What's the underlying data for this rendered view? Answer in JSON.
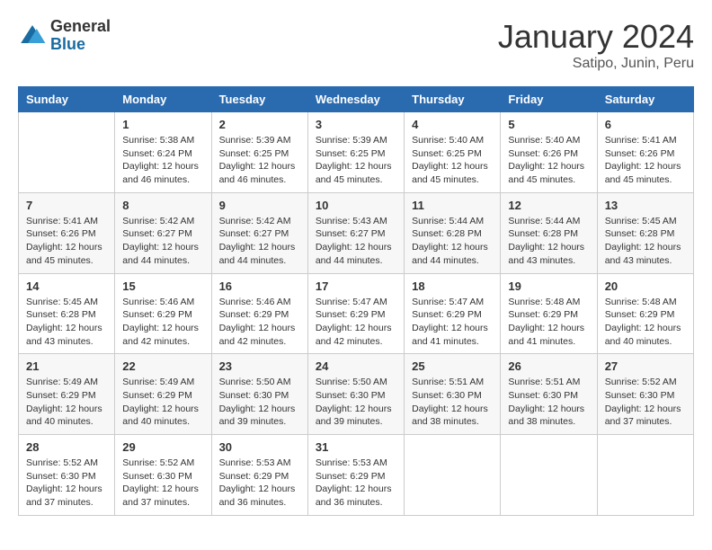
{
  "header": {
    "logo_general": "General",
    "logo_blue": "Blue",
    "title": "January 2024",
    "location": "Satipo, Junin, Peru"
  },
  "calendar": {
    "days_of_week": [
      "Sunday",
      "Monday",
      "Tuesday",
      "Wednesday",
      "Thursday",
      "Friday",
      "Saturday"
    ],
    "weeks": [
      [
        {
          "day": "",
          "info": ""
        },
        {
          "day": "1",
          "info": "Sunrise: 5:38 AM\nSunset: 6:24 PM\nDaylight: 12 hours and 46 minutes."
        },
        {
          "day": "2",
          "info": "Sunrise: 5:39 AM\nSunset: 6:25 PM\nDaylight: 12 hours and 46 minutes."
        },
        {
          "day": "3",
          "info": "Sunrise: 5:39 AM\nSunset: 6:25 PM\nDaylight: 12 hours and 45 minutes."
        },
        {
          "day": "4",
          "info": "Sunrise: 5:40 AM\nSunset: 6:25 PM\nDaylight: 12 hours and 45 minutes."
        },
        {
          "day": "5",
          "info": "Sunrise: 5:40 AM\nSunset: 6:26 PM\nDaylight: 12 hours and 45 minutes."
        },
        {
          "day": "6",
          "info": "Sunrise: 5:41 AM\nSunset: 6:26 PM\nDaylight: 12 hours and 45 minutes."
        }
      ],
      [
        {
          "day": "7",
          "info": "Sunrise: 5:41 AM\nSunset: 6:26 PM\nDaylight: 12 hours and 45 minutes."
        },
        {
          "day": "8",
          "info": "Sunrise: 5:42 AM\nSunset: 6:27 PM\nDaylight: 12 hours and 44 minutes."
        },
        {
          "day": "9",
          "info": "Sunrise: 5:42 AM\nSunset: 6:27 PM\nDaylight: 12 hours and 44 minutes."
        },
        {
          "day": "10",
          "info": "Sunrise: 5:43 AM\nSunset: 6:27 PM\nDaylight: 12 hours and 44 minutes."
        },
        {
          "day": "11",
          "info": "Sunrise: 5:44 AM\nSunset: 6:28 PM\nDaylight: 12 hours and 44 minutes."
        },
        {
          "day": "12",
          "info": "Sunrise: 5:44 AM\nSunset: 6:28 PM\nDaylight: 12 hours and 43 minutes."
        },
        {
          "day": "13",
          "info": "Sunrise: 5:45 AM\nSunset: 6:28 PM\nDaylight: 12 hours and 43 minutes."
        }
      ],
      [
        {
          "day": "14",
          "info": "Sunrise: 5:45 AM\nSunset: 6:28 PM\nDaylight: 12 hours and 43 minutes."
        },
        {
          "day": "15",
          "info": "Sunrise: 5:46 AM\nSunset: 6:29 PM\nDaylight: 12 hours and 42 minutes."
        },
        {
          "day": "16",
          "info": "Sunrise: 5:46 AM\nSunset: 6:29 PM\nDaylight: 12 hours and 42 minutes."
        },
        {
          "day": "17",
          "info": "Sunrise: 5:47 AM\nSunset: 6:29 PM\nDaylight: 12 hours and 42 minutes."
        },
        {
          "day": "18",
          "info": "Sunrise: 5:47 AM\nSunset: 6:29 PM\nDaylight: 12 hours and 41 minutes."
        },
        {
          "day": "19",
          "info": "Sunrise: 5:48 AM\nSunset: 6:29 PM\nDaylight: 12 hours and 41 minutes."
        },
        {
          "day": "20",
          "info": "Sunrise: 5:48 AM\nSunset: 6:29 PM\nDaylight: 12 hours and 40 minutes."
        }
      ],
      [
        {
          "day": "21",
          "info": "Sunrise: 5:49 AM\nSunset: 6:29 PM\nDaylight: 12 hours and 40 minutes."
        },
        {
          "day": "22",
          "info": "Sunrise: 5:49 AM\nSunset: 6:29 PM\nDaylight: 12 hours and 40 minutes."
        },
        {
          "day": "23",
          "info": "Sunrise: 5:50 AM\nSunset: 6:30 PM\nDaylight: 12 hours and 39 minutes."
        },
        {
          "day": "24",
          "info": "Sunrise: 5:50 AM\nSunset: 6:30 PM\nDaylight: 12 hours and 39 minutes."
        },
        {
          "day": "25",
          "info": "Sunrise: 5:51 AM\nSunset: 6:30 PM\nDaylight: 12 hours and 38 minutes."
        },
        {
          "day": "26",
          "info": "Sunrise: 5:51 AM\nSunset: 6:30 PM\nDaylight: 12 hours and 38 minutes."
        },
        {
          "day": "27",
          "info": "Sunrise: 5:52 AM\nSunset: 6:30 PM\nDaylight: 12 hours and 37 minutes."
        }
      ],
      [
        {
          "day": "28",
          "info": "Sunrise: 5:52 AM\nSunset: 6:30 PM\nDaylight: 12 hours and 37 minutes."
        },
        {
          "day": "29",
          "info": "Sunrise: 5:52 AM\nSunset: 6:30 PM\nDaylight: 12 hours and 37 minutes."
        },
        {
          "day": "30",
          "info": "Sunrise: 5:53 AM\nSunset: 6:29 PM\nDaylight: 12 hours and 36 minutes."
        },
        {
          "day": "31",
          "info": "Sunrise: 5:53 AM\nSunset: 6:29 PM\nDaylight: 12 hours and 36 minutes."
        },
        {
          "day": "",
          "info": ""
        },
        {
          "day": "",
          "info": ""
        },
        {
          "day": "",
          "info": ""
        }
      ]
    ]
  }
}
